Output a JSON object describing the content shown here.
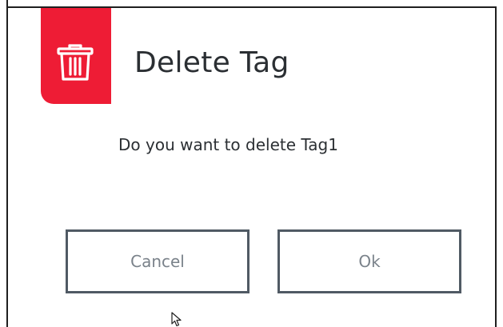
{
  "dialog": {
    "title": "Delete Tag",
    "message": "Do you want to delete Tag1",
    "icon": "trash-icon",
    "accent_color": "#ee1c35"
  },
  "buttons": {
    "cancel_label": "Cancel",
    "ok_label": "Ok"
  }
}
